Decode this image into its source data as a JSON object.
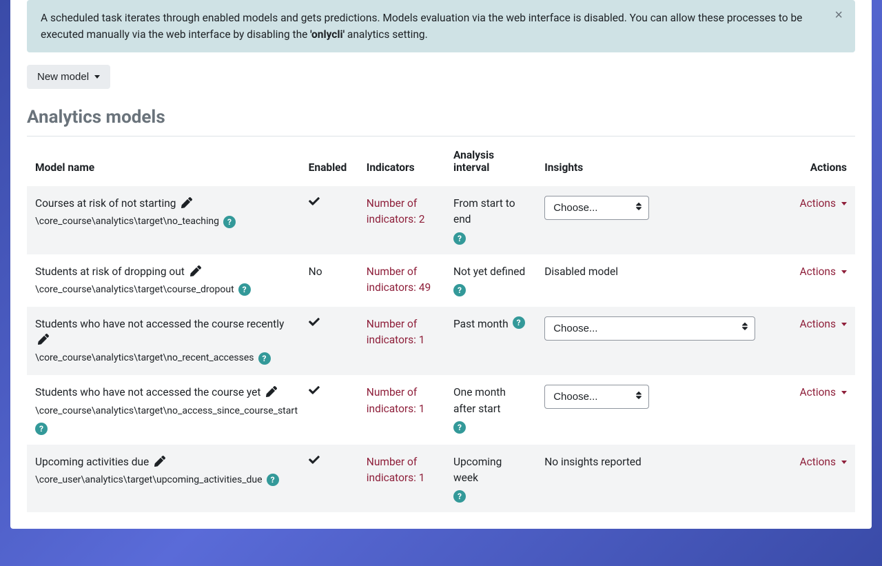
{
  "alert": {
    "text_before": "A scheduled task iterates through enabled models and gets predictions. Models evaluation via the web interface is disabled. You can allow these processes to be executed manually via the web interface by disabling the ",
    "bold": "'onlycli'",
    "text_after": " analytics setting.",
    "close": "×"
  },
  "new_model_label": "New model",
  "section_title": "Analytics models",
  "columns": {
    "name": "Model name",
    "enabled": "Enabled",
    "indicators": "Indicators",
    "interval": "Analysis interval",
    "insights": "Insights",
    "actions": "Actions"
  },
  "choose_label": "Choose...",
  "actions_label": "Actions",
  "help_glyph": "?",
  "no_label": "No",
  "models": [
    {
      "name": "Courses at risk of not starting",
      "target": "\\core_course\\analytics\\target\\no_teaching",
      "enabled": true,
      "indicators": "Number of indicators: 2",
      "interval": "From start to end",
      "insights_type": "select",
      "select_wide": false
    },
    {
      "name": "Students at risk of dropping out",
      "target": "\\core_course\\analytics\\target\\course_dropout",
      "enabled": false,
      "indicators": "Number of indicators: 49",
      "interval": "Not yet defined",
      "insights_type": "text",
      "insights_text": "Disabled model"
    },
    {
      "name": "Students who have not accessed the course recently",
      "target": "\\core_course\\analytics\\target\\no_recent_accesses",
      "enabled": true,
      "indicators": "Number of indicators: 1",
      "interval": "Past month",
      "insights_type": "select",
      "select_wide": true
    },
    {
      "name": "Students who have not accessed the course yet",
      "target": "\\core_course\\analytics\\target\\no_access_since_course_start",
      "enabled": true,
      "indicators": "Number of indicators: 1",
      "interval": "One month after start",
      "insights_type": "select",
      "select_wide": false
    },
    {
      "name": "Upcoming activities due",
      "target": "\\core_user\\analytics\\target\\upcoming_activities_due",
      "enabled": true,
      "indicators": "Number of indicators: 1",
      "interval": "Upcoming week",
      "insights_type": "text",
      "insights_text": "No insights reported"
    }
  ]
}
